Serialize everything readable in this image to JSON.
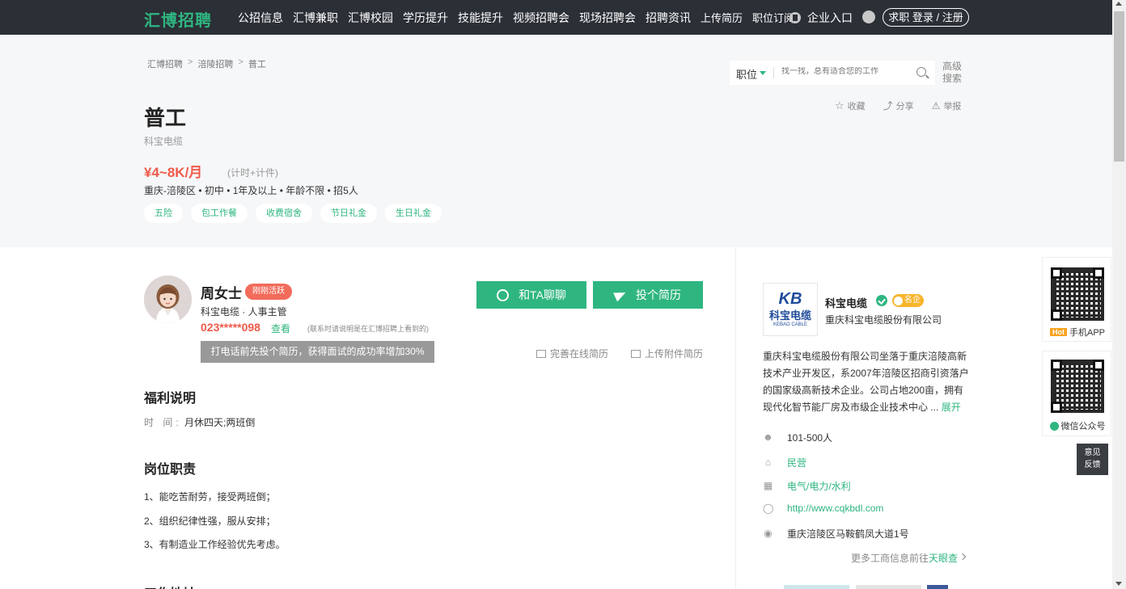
{
  "nav": {
    "logo": "汇博招聘",
    "items": [
      "公招信息",
      "汇博兼职",
      "汇博校园",
      "学历提升",
      "技能提升",
      "视频招聘会",
      "现场招聘会",
      "招聘资讯",
      "上传简历",
      "职位订阅"
    ],
    "enterprise": "企业入口",
    "login": "求职 登录 / 注册"
  },
  "breadcrumb": [
    "汇博招聘",
    "涪陵招聘",
    "普工"
  ],
  "search": {
    "type": "职位",
    "placeholder": "找一找，总有适合您的工作",
    "advanced": "高级搜索"
  },
  "actions": {
    "favorite": "收藏",
    "share": "分享",
    "report": "举报"
  },
  "job": {
    "title": "普工",
    "company": "科宝电缆",
    "salary": "¥4~8K/月",
    "salary_note": "(计时+计件)",
    "meta": "重庆-涪陵区 • 初中 • 1年及以上  • 年龄不限 • 招5人",
    "tags": [
      "五险",
      "包工作餐",
      "收费宿舍",
      "节日礼金",
      "生日礼金"
    ]
  },
  "recruiter": {
    "name": "周女士",
    "badge": "刚刚活跃",
    "role": "科宝电缆 · 人事主管",
    "phone": "023*****098",
    "phone_view": "查看",
    "phone_note": "(联系时请说明是在汇博招聘上看到的)",
    "tooltip": "打电话前先投个简历，获得面试的成功率增加30%"
  },
  "buttons": {
    "chat": "和TA聊聊",
    "resume": "投个简历",
    "online_resume": "完善在线简历",
    "upload_resume": "上传附件简历"
  },
  "benefits": {
    "title": "福利说明",
    "label": "时 间:",
    "value": "月休四天;两班倒"
  },
  "duties": {
    "title": "岗位职责",
    "items": [
      "1、能吃苦耐劳，接受两班倒；",
      "2、组织纪律性强，服从安排；",
      "3、有制造业工作经验优先考虑。"
    ]
  },
  "next_section": "工作地址",
  "company": {
    "logo_mark": "KB",
    "logo_cn": "科宝电缆",
    "logo_en": "KEBAO CABLE",
    "name": "科宝电缆",
    "famous": "名企",
    "fullname": "重庆科宝电缆股份有限公司",
    "desc": "重庆科宝电缆股份有限公司坐落于重庆涪陵高新技术产业开发区，系2007年涪陵区招商引资落户的国家级高新技术企业。公司占地200亩，拥有现代化智节能厂房及市级企业技术中心 ...",
    "expand": "展开",
    "size": "101-500人",
    "type": "民营",
    "industry": "电气/电力/水利",
    "website": "http://www.cqkbdl.com",
    "address": "重庆涪陵区马鞍鹤凤大道1号",
    "more_prefix": "更多工商信息前往",
    "more_link": "天眼查"
  },
  "side": {
    "app_hot": "Hot",
    "app_label": "手机APP",
    "wechat_label": "微信公众号",
    "feedback": [
      "意见",
      "反馈"
    ]
  },
  "colors": {
    "brand_green": "#2fb680",
    "salary_red": "#f05a4a",
    "nav_bg": "#2b2f36"
  }
}
